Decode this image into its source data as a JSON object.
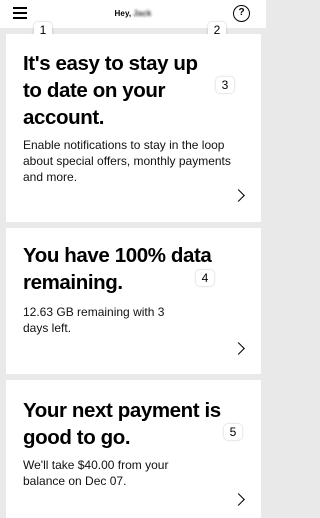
{
  "header": {
    "greeting": "Hey,",
    "user_name": "Jack",
    "menu_icon": "hamburger-menu-icon",
    "help_icon": "question-mark-icon",
    "help_glyph": "?"
  },
  "badges": [
    "1",
    "2",
    "3",
    "4",
    "5"
  ],
  "cards": [
    {
      "title": "It's easy to stay up to date on your account.",
      "body": "Enable notifications to stay in the loop about special offers, monthly payments and more."
    },
    {
      "title": "You have 100% data remaining.",
      "body": "12.63 GB remaining with 3 days left."
    },
    {
      "title": "Your next payment is good to go.",
      "body": "We'll take $40.00 from your balance on Dec 07."
    }
  ]
}
